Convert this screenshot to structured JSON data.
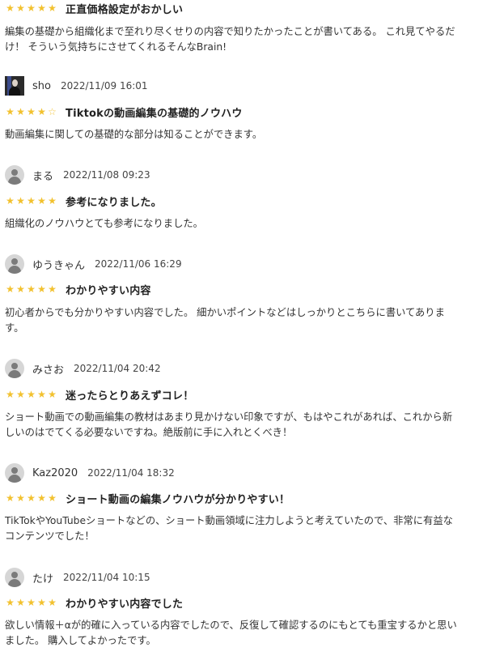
{
  "reviews": [
    {
      "user": "",
      "date": "",
      "avatar": "none",
      "rating": 5,
      "title": "正直価格設定がおかしい",
      "body": [
        "編集の基礎から組織化まで至れり尽くせりの内容で知りたかったことが書いてある。 これ見てやるだ",
        "け！ そういう気持ちにさせてくれるそんなBrain!"
      ]
    },
    {
      "user": "sho",
      "date": "2022/11/09 16:01",
      "avatar": "photo",
      "rating": 4,
      "title": "Tiktokの動画編集の基礎的ノウハウ",
      "body": [
        "動画編集に関しての基礎的な部分は知ることができます。"
      ]
    },
    {
      "user": "まる",
      "date": "2022/11/08 09:23",
      "avatar": "default-user-icon",
      "rating": 5,
      "title": "参考になりました。",
      "body": [
        "組織化のノウハウとても参考になりました。"
      ]
    },
    {
      "user": "ゆうきゃん",
      "date": "2022/11/06 16:29",
      "avatar": "default-user-icon",
      "rating": 5,
      "title": "わかりやすい内容",
      "body": [
        "初心者からでも分かりやすい内容でした。 細かいポイントなどはしっかりとこちらに書いてありま",
        "す。"
      ]
    },
    {
      "user": "みさお",
      "date": "2022/11/04 20:42",
      "avatar": "default-user-icon",
      "rating": 5,
      "title": "迷ったらとりあえずコレ！",
      "body": [
        "ショート動画での動画編集の教材はあまり見かけない印象ですが、もはやこれがあれば、これから新",
        "しいのはでてくる必要ないですね。絶版前に手に入れとくべき！"
      ]
    },
    {
      "user": "Kaz2020",
      "date": "2022/11/04 18:32",
      "avatar": "default-user-icon",
      "rating": 5,
      "title": "ショート動画の編集ノウハウが分かりやすい！",
      "body": [
        "TikTokやYouTubeショートなどの、ショート動画領域に注力しようと考えていたので、非常に有益な",
        "コンテンツでした！"
      ]
    },
    {
      "user": "たけ",
      "date": "2022/11/04 10:15",
      "avatar": "default-user-icon",
      "rating": 5,
      "title": "わかりやすい内容でした",
      "body": [
        "欲しい情報＋αが的確に入っている内容でしたので、反復して確認するのにもとても重宝するかと思い",
        "ました。 購入してよかったです。"
      ]
    }
  ],
  "icons": {
    "star_filled": "star-icon",
    "star_empty": "star-outline-icon",
    "avatar": "user-icon"
  },
  "colors": {
    "star": "#f2c12e",
    "text": "#333333",
    "avatar_bg": "#d6d6d6"
  }
}
